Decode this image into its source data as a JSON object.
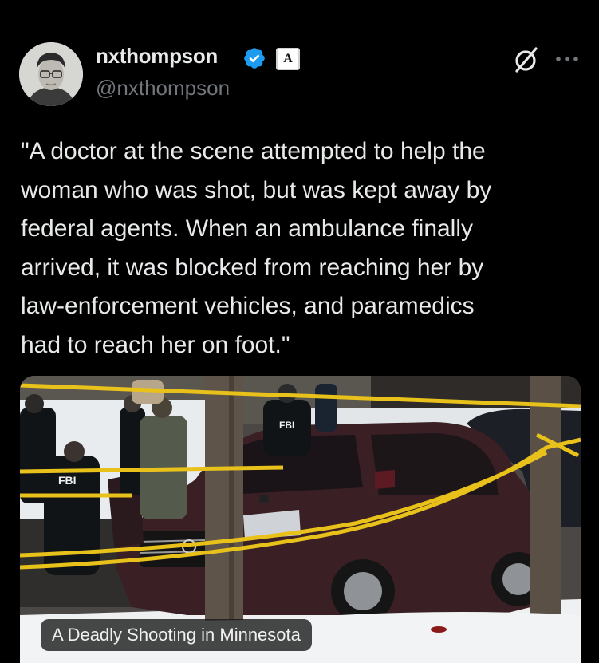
{
  "author": {
    "display_name": "nxthompson",
    "handle": "@nxthompson",
    "affiliate_badge": "A",
    "verified_color": "#1d9bf0"
  },
  "header_icons": [
    "grok-icon",
    "more-icon"
  ],
  "tweet": {
    "text": "\"A doctor at the scene attempted to help the\nwoman who was shot, but was kept away by\nfederal agents. When an ambulance finally\narrived, it was blocked from reaching her by\nlaw-enforcement vehicles, and paramedics\nhad to reach her on foot.\""
  },
  "media": {
    "caption": "A Deadly Shooting in Minnesota",
    "vest_labels": [
      "FBI",
      "FBI"
    ]
  },
  "colors": {
    "background": "#000000",
    "text": "#e7e9ea",
    "secondary_text": "#71767b",
    "police_tape": "#e8c21a"
  }
}
